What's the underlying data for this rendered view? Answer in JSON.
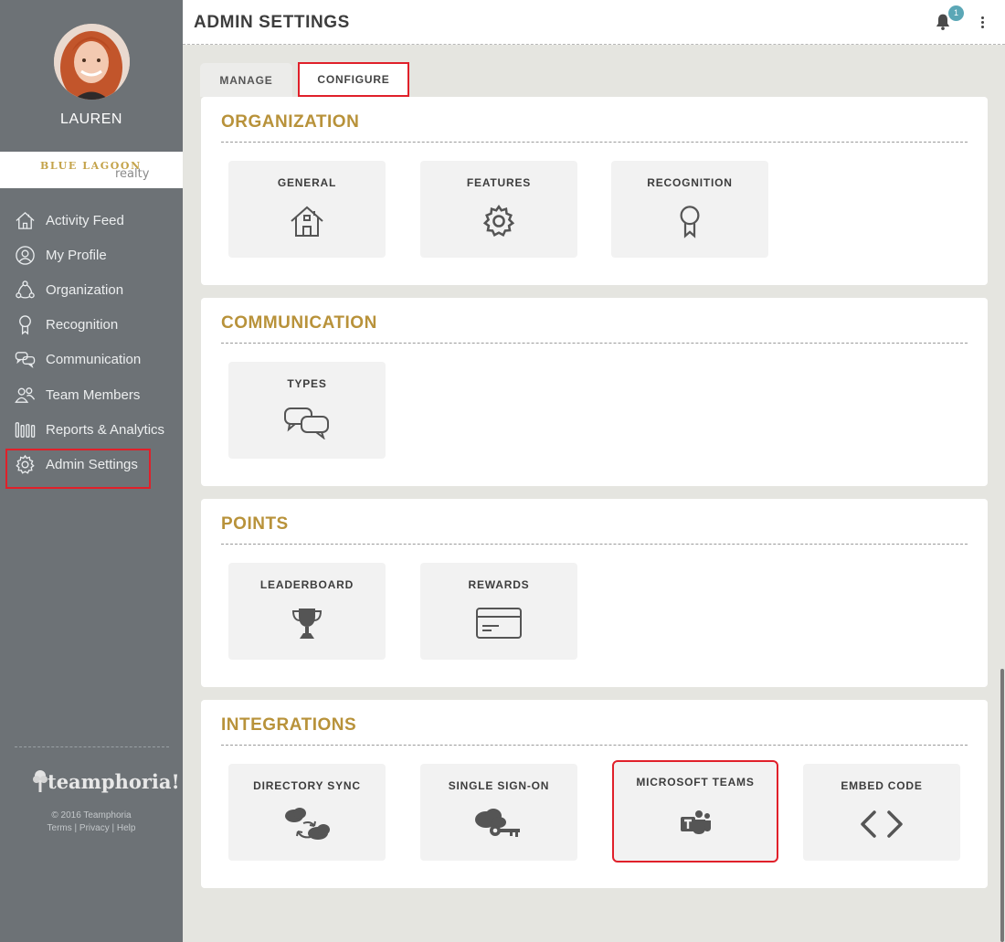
{
  "user": {
    "name": "LAUREN"
  },
  "brand": {
    "main": "BLUE LAGOON",
    "sub": "realty"
  },
  "nav": [
    {
      "label": "Activity Feed",
      "icon": "home-icon"
    },
    {
      "label": "My Profile",
      "icon": "user-icon"
    },
    {
      "label": "Organization",
      "icon": "organization-icon"
    },
    {
      "label": "Recognition",
      "icon": "ribbon-icon"
    },
    {
      "label": "Communication",
      "icon": "chat-icon"
    },
    {
      "label": "Team Members",
      "icon": "team-icon"
    },
    {
      "label": "Reports & Analytics",
      "icon": "bars-icon"
    },
    {
      "label": "Admin Settings",
      "icon": "gear-icon",
      "active": true
    }
  ],
  "footer": {
    "logo": "teamphoria!",
    "copyright": "© 2016 Teamphoria",
    "terms": "Terms",
    "privacy": "Privacy",
    "help": "Help",
    "sep": "|"
  },
  "header": {
    "title": "ADMIN SETTINGS",
    "notification_count": "1"
  },
  "tabs": [
    {
      "label": "MANAGE"
    },
    {
      "label": "CONFIGURE",
      "active": true
    }
  ],
  "sections": [
    {
      "title": "ORGANIZATION",
      "cards": [
        {
          "label": "GENERAL",
          "icon": "house-icon"
        },
        {
          "label": "FEATURES",
          "icon": "gear-icon"
        },
        {
          "label": "RECOGNITION",
          "icon": "ribbon-icon"
        }
      ]
    },
    {
      "title": "COMMUNICATION",
      "cards": [
        {
          "label": "TYPES",
          "icon": "chat-bubbles-icon"
        }
      ]
    },
    {
      "title": "POINTS",
      "cards": [
        {
          "label": "LEADERBOARD",
          "icon": "trophy-icon"
        },
        {
          "label": "REWARDS",
          "icon": "card-icon"
        }
      ]
    },
    {
      "title": "INTEGRATIONS",
      "cards": [
        {
          "label": "DIRECTORY SYNC",
          "icon": "cloud-sync-icon"
        },
        {
          "label": "SINGLE SIGN-ON",
          "icon": "cloud-key-icon"
        },
        {
          "label": "MICROSOFT TEAMS",
          "icon": "teams-icon",
          "highlight": true
        },
        {
          "label": "EMBED CODE",
          "icon": "code-icon"
        }
      ]
    }
  ],
  "colors": {
    "sidebar": "#6d7276",
    "accent_gold": "#b8923a",
    "highlight_red": "#e0202a",
    "badge": "#5ba7b6"
  }
}
